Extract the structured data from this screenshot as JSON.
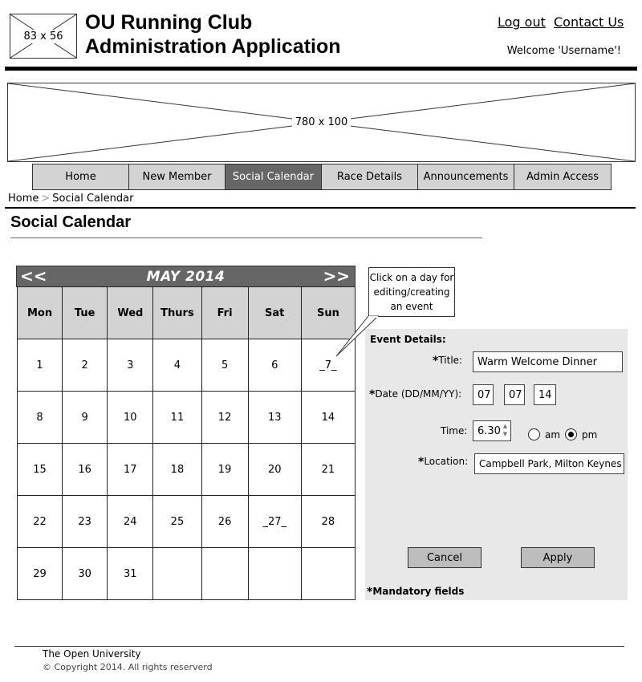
{
  "header": {
    "logo_placeholder": "83 x 56",
    "title_line1": "OU Running Club",
    "title_line2": "Administration Application",
    "logout_label": "Log out",
    "contact_label": "Contact Us",
    "welcome_text": "Welcome 'Username'!"
  },
  "banner": {
    "placeholder": "780 x 100"
  },
  "nav": {
    "items": [
      {
        "label": "Home"
      },
      {
        "label": "New Member"
      },
      {
        "label": "Social Calendar"
      },
      {
        "label": "Race Details"
      },
      {
        "label": "Announcements"
      },
      {
        "label": "Admin Access"
      }
    ],
    "active": "Social Calendar"
  },
  "breadcrumb": {
    "home": "Home",
    "separator": ">",
    "current": "Social Calendar"
  },
  "page_title": "Social Calendar",
  "calendar": {
    "prev_label": "<<",
    "next_label": ">>",
    "month_label": "MAY 2014",
    "day_headers": [
      "Mon",
      "Tue",
      "Wed",
      "Thurs",
      "Fri",
      "Sat",
      "Sun"
    ],
    "weeks": [
      [
        "1",
        "2",
        "3",
        "4",
        "5",
        "6",
        "_7_"
      ],
      [
        "8",
        "9",
        "10",
        "11",
        "12",
        "13",
        "14"
      ],
      [
        "15",
        "16",
        "17",
        "18",
        "19",
        "20",
        "21"
      ],
      [
        "22",
        "23",
        "24",
        "25",
        "26",
        "_27_",
        "28"
      ],
      [
        "29",
        "30",
        "31",
        "",
        "",
        "",
        ""
      ]
    ]
  },
  "callout": {
    "text": "Click on a day for editing/creating an event"
  },
  "event": {
    "heading": "Event Details:",
    "required_marker": "*",
    "title_label": "Title:",
    "title_value": "Warm Welcome Dinner",
    "date_label": "Date (DD/MM/YY):",
    "date_day": "07",
    "date_month": "07",
    "date_year": "14",
    "time_label": "Time:",
    "time_value": "6.30",
    "am_label": "am",
    "pm_label": "pm",
    "selected_meridiem": "pm",
    "location_label": "Location:",
    "location_value": "Campbell Park, Milton Keynes",
    "cancel_label": "Cancel",
    "apply_label": "Apply",
    "mandatory_note": "Mandatory fields"
  },
  "footer": {
    "line1": "The Open University",
    "line2": "© Copyright 2014. All rights reserverd"
  }
}
